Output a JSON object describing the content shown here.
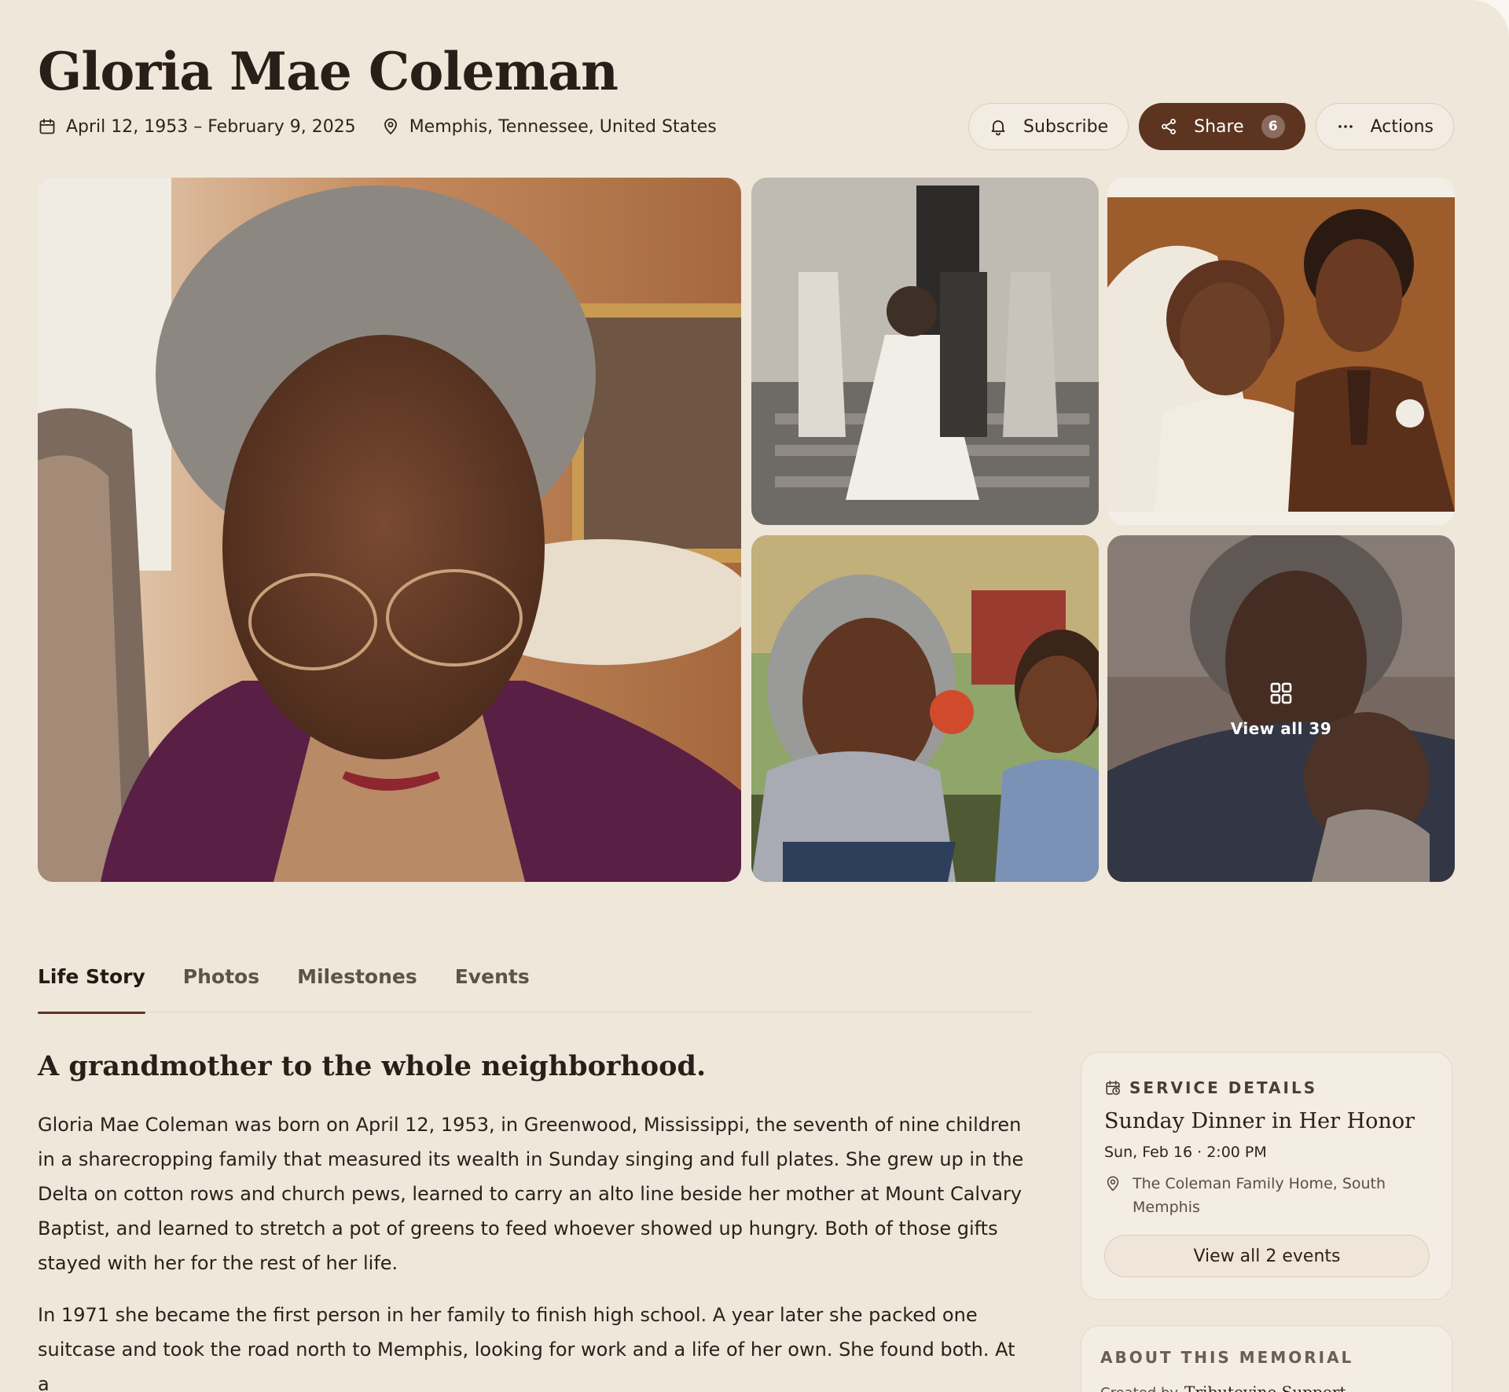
{
  "memorial": {
    "name": "Gloria Mae Coleman",
    "dates": "April 12, 1953 – February 9, 2025",
    "location": "Memphis, Tennessee, United States"
  },
  "actions": {
    "subscribe_label": "Subscribe",
    "share_label": "Share",
    "share_count": "6",
    "actions_label": "Actions"
  },
  "gallery": {
    "view_all_label": "View all 39"
  },
  "tabs": [
    {
      "label": "Life Story",
      "active": true
    },
    {
      "label": "Photos",
      "active": false
    },
    {
      "label": "Milestones",
      "active": false
    },
    {
      "label": "Events",
      "active": false
    }
  ],
  "story": {
    "heading": "A grandmother to the whole neighborhood.",
    "paragraphs": [
      "Gloria Mae Coleman was born on April 12, 1953, in Greenwood, Mississippi, the seventh of nine children in a sharecropping family that measured its wealth in Sunday singing and full plates. She grew up in the Delta on cotton rows and church pews, learned to carry an alto line beside her mother at Mount Calvary Baptist, and learned to stretch a pot of greens to feed whoever showed up hungry. Both of those gifts stayed with her for the rest of her life.",
      "In 1971 she became the first person in her family to finish high school. A year later she packed one suitcase and took the road north to Memphis, looking for work and a life of her own. She found both. At a"
    ]
  },
  "service": {
    "eyebrow": "SERVICE DETAILS",
    "name": "Sunday Dinner in Her Honor",
    "datetime": "Sun, Feb 16 · 2:00 PM",
    "location": "The Coleman Family Home, South Memphis",
    "button_label": "View all 2 events"
  },
  "about": {
    "eyebrow": "ABOUT THIS MEMORIAL",
    "created_by_label": "Created by",
    "creator": "Tributevine Support"
  },
  "colors": {
    "accent": "#5c3420",
    "background": "#efe7da",
    "card": "#f3ede4"
  },
  "icons": [
    "calendar-icon",
    "map-pin-icon",
    "bell-icon",
    "share-icon",
    "more-icon",
    "grid-icon",
    "calendar-clock-icon"
  ]
}
